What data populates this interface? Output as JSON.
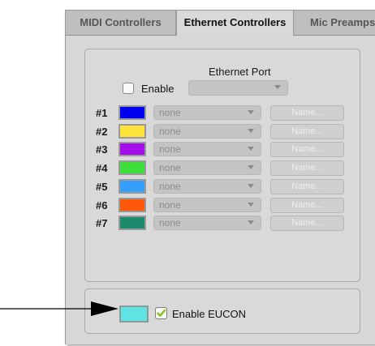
{
  "tabs": [
    {
      "label": "MIDI Controllers",
      "active": false
    },
    {
      "label": "Ethernet Controllers",
      "active": true
    },
    {
      "label": "Mic Preamps",
      "active": false
    }
  ],
  "ethernet_port": {
    "label": "Ethernet Port",
    "enable_label": "Enable",
    "enable_checked": false,
    "port_value": ""
  },
  "controllers": [
    {
      "num": "#1",
      "color": "#0000f0",
      "device": "none",
      "name_button": "Name..."
    },
    {
      "num": "#2",
      "color": "#ffe23a",
      "device": "none",
      "name_button": "Name..."
    },
    {
      "num": "#3",
      "color": "#a20dea",
      "device": "none",
      "name_button": "Name..."
    },
    {
      "num": "#4",
      "color": "#3ede3a",
      "device": "none",
      "name_button": "Name..."
    },
    {
      "num": "#5",
      "color": "#34a0fb",
      "device": "none",
      "name_button": "Name..."
    },
    {
      "num": "#6",
      "color": "#ff580a",
      "device": "none",
      "name_button": "Name..."
    },
    {
      "num": "#7",
      "color": "#1c8b6d",
      "device": "none",
      "name_button": "Name..."
    }
  ],
  "eucon": {
    "color": "#62e3e3",
    "label": "Enable EUCON",
    "checked": true,
    "check_color": "#8cc21f"
  }
}
